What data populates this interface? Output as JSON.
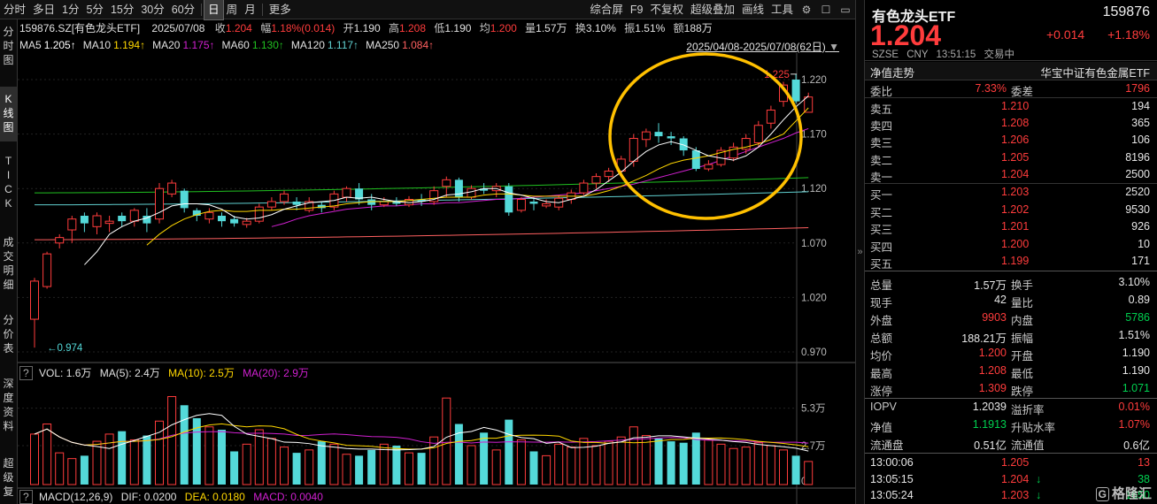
{
  "toolbar": {
    "items": [
      "分时",
      "多日",
      "1分",
      "5分",
      "15分",
      "30分",
      "60分",
      "日",
      "周",
      "月",
      "更多"
    ],
    "active_index": 7,
    "right_items": [
      "综合屏",
      "F9",
      "不复权",
      "超级叠加",
      "画线",
      "工具"
    ],
    "icons": [
      "gear-icon",
      "square-icon"
    ]
  },
  "left_tabs": [
    {
      "label": "分时图"
    },
    {
      "label": "K线图",
      "active": true
    },
    {
      "label": "TICK"
    },
    {
      "label": "成交明细"
    },
    {
      "label": "分价表"
    },
    {
      "label": "深度资料"
    },
    {
      "label": "超级复"
    }
  ],
  "header": {
    "code_name": "159876.SZ[有色龙头ETF]",
    "date": "2025/07/08",
    "close_label": "收",
    "close": "1.204",
    "change_label": "幅",
    "change": "1.18%(0.014)",
    "open_label": "开",
    "open": "1.190",
    "high_label": "高",
    "high": "1.208",
    "low_label": "低",
    "low": "1.190",
    "avg_label": "均",
    "avg": "1.200",
    "vol_label": "量",
    "vol": "1.57万",
    "turn_label": "换",
    "turn": "3.10%",
    "amp_label": "振",
    "amp": "1.51%",
    "amt_label": "额",
    "amt": "188万",
    "range": "2025/04/08-2025/07/08(62日)"
  },
  "ma_legend": [
    {
      "label": "MA5",
      "value": "1.205↑",
      "color": "#ffffff"
    },
    {
      "label": "MA10",
      "value": "1.194↑",
      "color": "#ffd700"
    },
    {
      "label": "MA20",
      "value": "1.175↑",
      "color": "#d020d0"
    },
    {
      "label": "MA60",
      "value": "1.130↑",
      "color": "#20c020"
    },
    {
      "label": "MA120",
      "value": "1.117↑",
      "color": "#60d0d0"
    },
    {
      "label": "MA250",
      "value": "1.084↑",
      "color": "#ff6060"
    }
  ],
  "vol_legend": {
    "title": "VOL: 1.6万",
    "ma5": "MA(5): 2.4万",
    "ma10": "MA(10): 2.5万",
    "ma20": "MA(20): 2.9万"
  },
  "macd_legend": {
    "title": "MACD(12,26,9)",
    "dif": "DIF: 0.0200",
    "dea": "DEA: 0.0180",
    "macd": "MACD: 0.0040"
  },
  "colors": {
    "up": "#ff3c3c",
    "down": "#54d9d9",
    "ma5": "#ffffff",
    "ma10": "#ffd700",
    "ma20": "#d020d0",
    "ma60": "#20c020",
    "ma120": "#60d0d0",
    "ma250": "#ff6060",
    "highlight": "#ffc000"
  },
  "chart_data": {
    "type": "candlestick",
    "y_ticks": [
      "1.220",
      "1.170",
      "1.120",
      "1.070",
      "1.020",
      "0.970"
    ],
    "y_values": [
      1.22,
      1.17,
      1.12,
      1.07,
      1.02,
      0.97
    ],
    "vol_ticks": [
      "5.3万",
      "2.7万",
      "0"
    ],
    "vol_values": [
      5.3,
      2.7,
      0
    ],
    "max_label": "1.225",
    "min_label": "0.974",
    "candles": [
      [
        1.0,
        1.035,
        0.974,
        1.038
      ],
      [
        1.03,
        1.06,
        1.028,
        1.062
      ],
      [
        1.07,
        1.075,
        1.065,
        1.078
      ],
      [
        1.082,
        1.092,
        1.07,
        1.095
      ],
      [
        1.095,
        1.088,
        1.08,
        1.098
      ],
      [
        1.085,
        1.095,
        1.078,
        1.098
      ],
      [
        1.088,
        1.09,
        1.08,
        1.095
      ],
      [
        1.095,
        1.09,
        1.085,
        1.098
      ],
      [
        1.09,
        1.1,
        1.085,
        1.102
      ],
      [
        1.095,
        1.088,
        1.08,
        1.102
      ],
      [
        1.092,
        1.12,
        1.088,
        1.125
      ],
      [
        1.115,
        1.125,
        1.112,
        1.128
      ],
      [
        1.118,
        1.102,
        1.098,
        1.12
      ],
      [
        1.1,
        1.095,
        1.09,
        1.102
      ],
      [
        1.092,
        1.098,
        1.088,
        1.102
      ],
      [
        1.095,
        1.09,
        1.085,
        1.098
      ],
      [
        1.092,
        1.088,
        1.085,
        1.095
      ],
      [
        1.087,
        1.09,
        1.084,
        1.093
      ],
      [
        1.09,
        1.103,
        1.088,
        1.106
      ],
      [
        1.103,
        1.108,
        1.1,
        1.112
      ],
      [
        1.108,
        1.115,
        1.105,
        1.118
      ],
      [
        1.108,
        1.105,
        1.1,
        1.112
      ],
      [
        1.1,
        1.108,
        1.098,
        1.112
      ],
      [
        1.105,
        1.102,
        1.098,
        1.108
      ],
      [
        1.103,
        1.115,
        1.1,
        1.118
      ],
      [
        1.112,
        1.12,
        1.108,
        1.122
      ],
      [
        1.12,
        1.11,
        1.105,
        1.125
      ],
      [
        1.11,
        1.105,
        1.1,
        1.115
      ],
      [
        1.105,
        1.108,
        1.103,
        1.112
      ],
      [
        1.108,
        1.106,
        1.104,
        1.112
      ],
      [
        1.105,
        1.11,
        1.103,
        1.113
      ],
      [
        1.11,
        1.108,
        1.104,
        1.115
      ],
      [
        1.108,
        1.118,
        1.105,
        1.122
      ],
      [
        1.122,
        1.128,
        1.112,
        1.131
      ],
      [
        1.128,
        1.112,
        1.108,
        1.13
      ],
      [
        1.112,
        1.12,
        1.11,
        1.123
      ],
      [
        1.12,
        1.118,
        1.115,
        1.125
      ],
      [
        1.118,
        1.122,
        1.112,
        1.125
      ],
      [
        1.122,
        1.098,
        1.095,
        1.125
      ],
      [
        1.1,
        1.11,
        1.098,
        1.112
      ],
      [
        1.108,
        1.106,
        1.1,
        1.112
      ],
      [
        1.104,
        1.106,
        1.102,
        1.11
      ],
      [
        1.103,
        1.111,
        1.1,
        1.114
      ],
      [
        1.11,
        1.116,
        1.106,
        1.119
      ],
      [
        1.116,
        1.125,
        1.114,
        1.128
      ],
      [
        1.125,
        1.131,
        1.12,
        1.134
      ],
      [
        1.131,
        1.136,
        1.126,
        1.139
      ],
      [
        1.136,
        1.147,
        1.133,
        1.15
      ],
      [
        1.145,
        1.166,
        1.14,
        1.17
      ],
      [
        1.165,
        1.172,
        1.158,
        1.175
      ],
      [
        1.172,
        1.168,
        1.162,
        1.18
      ],
      [
        1.168,
        1.166,
        1.16,
        1.172
      ],
      [
        1.166,
        1.155,
        1.15,
        1.168
      ],
      [
        1.155,
        1.138,
        1.136,
        1.158
      ],
      [
        1.138,
        1.142,
        1.136,
        1.146
      ],
      [
        1.142,
        1.155,
        1.14,
        1.158
      ],
      [
        1.148,
        1.158,
        1.145,
        1.162
      ],
      [
        1.156,
        1.166,
        1.152,
        1.17
      ],
      [
        1.162,
        1.178,
        1.158,
        1.182
      ],
      [
        1.18,
        1.192,
        1.175,
        1.196
      ],
      [
        1.2,
        1.215,
        1.195,
        1.218
      ],
      [
        1.22,
        1.2,
        1.198,
        1.225
      ],
      [
        1.19,
        1.204,
        1.19,
        1.208
      ]
    ],
    "ma5": [
      null,
      null,
      null,
      null,
      1.05,
      1.062,
      1.078,
      1.085,
      1.09,
      1.093,
      1.098,
      1.104,
      1.106,
      1.106,
      1.105,
      1.101,
      1.094,
      1.092,
      1.093,
      1.096,
      1.101,
      1.104,
      1.107,
      1.108,
      1.109,
      1.112,
      1.111,
      1.112,
      1.11,
      1.108,
      1.107,
      1.108,
      1.11,
      1.114,
      1.115,
      1.117,
      1.12,
      1.12,
      1.116,
      1.114,
      1.111,
      1.108,
      1.107,
      1.11,
      1.113,
      1.119,
      1.127,
      1.135,
      1.145,
      1.154,
      1.16,
      1.163,
      1.16,
      1.155,
      1.15,
      1.148,
      1.146,
      1.15,
      1.158,
      1.17,
      1.183,
      1.195,
      1.205
    ],
    "ma10": [
      null,
      null,
      null,
      null,
      null,
      null,
      null,
      null,
      null,
      1.068,
      1.078,
      1.086,
      1.092,
      1.096,
      1.099,
      1.1,
      1.099,
      1.099,
      1.1,
      1.1,
      1.101,
      1.101,
      1.102,
      1.103,
      1.104,
      1.106,
      1.107,
      1.108,
      1.108,
      1.108,
      1.109,
      1.11,
      1.111,
      1.112,
      1.112,
      1.112,
      1.114,
      1.115,
      1.115,
      1.114,
      1.113,
      1.113,
      1.113,
      1.113,
      1.113,
      1.115,
      1.118,
      1.122,
      1.127,
      1.132,
      1.138,
      1.143,
      1.146,
      1.148,
      1.15,
      1.153,
      1.156,
      1.158,
      1.161,
      1.165,
      1.17,
      1.182,
      1.194
    ],
    "ma20": [
      null,
      null,
      null,
      null,
      null,
      null,
      null,
      null,
      null,
      null,
      null,
      null,
      null,
      null,
      null,
      null,
      null,
      null,
      null,
      1.085,
      1.088,
      1.092,
      1.095,
      1.097,
      1.099,
      1.101,
      1.102,
      1.103,
      1.104,
      1.104,
      1.105,
      1.106,
      1.106,
      1.107,
      1.107,
      1.108,
      1.109,
      1.11,
      1.11,
      1.111,
      1.112,
      1.113,
      1.114,
      1.115,
      1.116,
      1.118,
      1.12,
      1.122,
      1.124,
      1.127,
      1.13,
      1.133,
      1.136,
      1.139,
      1.142,
      1.146,
      1.15,
      1.154,
      1.158,
      1.162,
      1.166,
      1.171,
      1.175
    ],
    "ma60_start": 1.116,
    "ma60_end": 1.13,
    "ma120_start": 1.105,
    "ma120_end": 1.117,
    "ma250_start": 1.073,
    "ma250_end": 1.084,
    "volumes": [
      3.5,
      4.2,
      2.2,
      1.8,
      2.0,
      3.0,
      3.5,
      3.7,
      3.1,
      3.4,
      4.4,
      6.1,
      5.5,
      4.6,
      4.0,
      3.8,
      2.3,
      2.8,
      3.8,
      3.2,
      2.6,
      2.2,
      2.4,
      3.0,
      2.8,
      2.1,
      2.0,
      2.4,
      2.8,
      2.7,
      2.2,
      2.2,
      3.3,
      6.0,
      4.2,
      2.7,
      3.6,
      2.4,
      4.5,
      3.1,
      2.3,
      2.0,
      2.8,
      2.6,
      3.2,
      2.7,
      3.0,
      3.3,
      4.0,
      3.4,
      3.2,
      3.0,
      2.9,
      3.6,
      3.1,
      2.8,
      2.5,
      2.6,
      2.9,
      2.7,
      2.4,
      2.0,
      1.6
    ]
  },
  "quote": {
    "name": "有色龙头ETF",
    "code": "159876",
    "price": "1.204",
    "change": "+0.014",
    "change_pct": "+1.18%",
    "market": "SZSE",
    "currency": "CNY",
    "time": "13:51:15",
    "status": "交易中",
    "nav_tab": "净值走势",
    "index_name": "华宝中证有色金属ETF",
    "wb_label": "委比",
    "wb": "7.33%",
    "wc_label": "委差",
    "wc": "1796",
    "asks": [
      {
        "label": "卖五",
        "price": "1.210",
        "vol": "194"
      },
      {
        "label": "卖四",
        "price": "1.208",
        "vol": "365"
      },
      {
        "label": "卖三",
        "price": "1.206",
        "vol": "106"
      },
      {
        "label": "卖二",
        "price": "1.205",
        "vol": "8196"
      },
      {
        "label": "卖一",
        "price": "1.204",
        "vol": "2500"
      }
    ],
    "bids": [
      {
        "label": "买一",
        "price": "1.203",
        "vol": "2520"
      },
      {
        "label": "买二",
        "price": "1.202",
        "vol": "9530"
      },
      {
        "label": "买三",
        "price": "1.201",
        "vol": "926"
      },
      {
        "label": "买四",
        "price": "1.200",
        "vol": "10"
      },
      {
        "label": "买五",
        "price": "1.199",
        "vol": "171"
      }
    ],
    "stats": [
      {
        "l1": "总量",
        "v1": "1.57万",
        "c1": "white",
        "l2": "换手",
        "v2": "3.10%",
        "c2": "white"
      },
      {
        "l1": "现手",
        "v1": "42",
        "c1": "white",
        "l2": "量比",
        "v2": "0.89",
        "c2": "white"
      },
      {
        "l1": "外盘",
        "v1": "9903",
        "c1": "red",
        "l2": "内盘",
        "v2": "5786",
        "c2": "green"
      },
      {
        "l1": "总额",
        "v1": "188.21万",
        "c1": "white",
        "l2": "振幅",
        "v2": "1.51%",
        "c2": "white"
      },
      {
        "l1": "均价",
        "v1": "1.200",
        "c1": "red",
        "l2": "开盘",
        "v2": "1.190",
        "c2": "white"
      },
      {
        "l1": "最高",
        "v1": "1.208",
        "c1": "red",
        "l2": "最低",
        "v2": "1.190",
        "c2": "white"
      },
      {
        "l1": "涨停",
        "v1": "1.309",
        "c1": "red",
        "l2": "跌停",
        "v2": "1.071",
        "c2": "green"
      }
    ],
    "iopv": [
      {
        "l1": "IOPV",
        "v1": "1.2039",
        "c1": "white",
        "l2": "溢折率",
        "v2": "0.01%",
        "c2": "red"
      },
      {
        "l1": "净值",
        "v1": "1.1913",
        "c1": "green",
        "l2": "升贴水率",
        "v2": "1.07%",
        "c2": "red"
      },
      {
        "l1": "流通盘",
        "v1": "0.51亿",
        "c1": "white",
        "l2": "流通值",
        "v2": "0.6亿",
        "c2": "white"
      }
    ],
    "ticks": [
      {
        "time": "13:00:06",
        "price": "1.205",
        "vol": "13",
        "dir": ""
      },
      {
        "time": "13:05:15",
        "price": "1.204",
        "vol": "38",
        "dir": "↓"
      },
      {
        "time": "13:05:24",
        "price": "1.203",
        "vol": "1650",
        "dir": "↓"
      }
    ],
    "watermark": "格隆汇"
  }
}
